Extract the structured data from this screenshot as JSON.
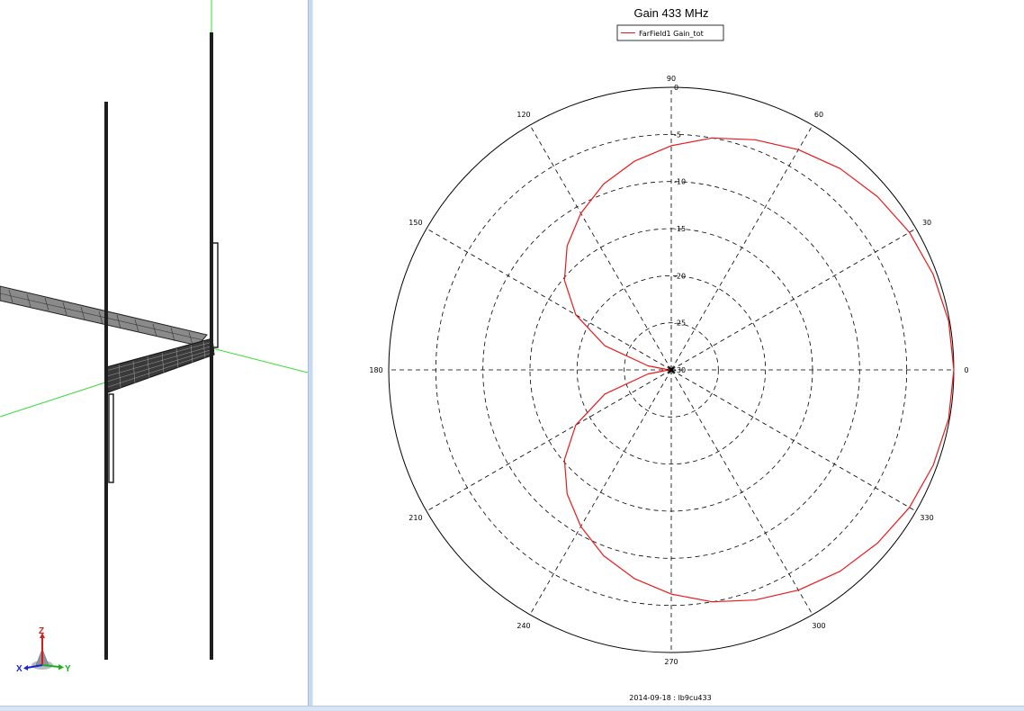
{
  "view3d": {
    "triad": {
      "z_label": "Z",
      "x_label": "X",
      "y_label": "Y",
      "z_color": "#d81b1b",
      "x_color": "#2222cc",
      "y_color": "#1fae1f"
    },
    "axis_color": "#33dd33",
    "structure_color": "#222222"
  },
  "chart_data": {
    "type": "polar",
    "title": "Gain 433 MHz",
    "legend": {
      "entries": [
        "FarField1 Gain_tot"
      ],
      "placement": "top-center"
    },
    "footer": "2014-09-18 : lb9cu433",
    "angle_ticks": [
      "0",
      "30",
      "60",
      "90",
      "120",
      "150",
      "180",
      "210",
      "240",
      "270",
      "300",
      "330"
    ],
    "angle_values": [
      0,
      30,
      60,
      90,
      120,
      150,
      180,
      210,
      240,
      270,
      300,
      330
    ],
    "radial_ticks": [
      "0",
      "-5",
      "-10",
      "-15",
      "-20",
      "-25",
      "-30"
    ],
    "radial_values": [
      0,
      -5,
      -10,
      -15,
      -20,
      -25,
      -30
    ],
    "r_range": [
      -30,
      0
    ],
    "grid": true,
    "series": [
      {
        "name": "FarField1 Gain_tot",
        "color": "#e8191b",
        "angle_deg": [
          0,
          10,
          20,
          30,
          40,
          50,
          60,
          70,
          80,
          90,
          100,
          110,
          120,
          130,
          140,
          150,
          160,
          170,
          175,
          180,
          185,
          190,
          200,
          210,
          220,
          230,
          240,
          250,
          260,
          270,
          280,
          290,
          300,
          310,
          320,
          330,
          340,
          350,
          360
        ],
        "gain_db": [
          0,
          -0.1,
          -0.4,
          -0.8,
          -1.4,
          -2.1,
          -3.0,
          -4.0,
          -5.0,
          -6.2,
          -7.5,
          -9.0,
          -10.8,
          -12.8,
          -15.2,
          -18.3,
          -22.5,
          -27.5,
          -29.5,
          -30.0,
          -29.5,
          -27.5,
          -22.5,
          -18.3,
          -15.2,
          -12.8,
          -10.8,
          -9.0,
          -7.5,
          -6.2,
          -5.0,
          -4.0,
          -3.0,
          -2.1,
          -1.4,
          -0.8,
          -0.4,
          -0.1,
          0
        ]
      }
    ]
  }
}
